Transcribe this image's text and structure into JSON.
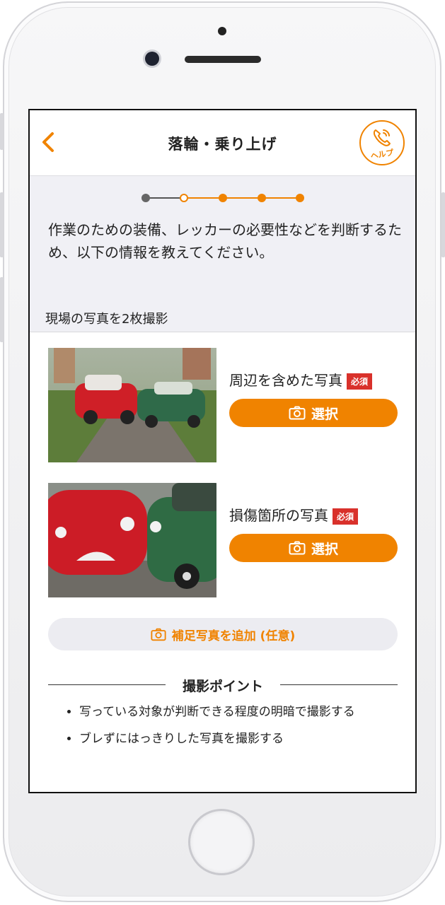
{
  "header": {
    "title": "落輪・乗り上げ",
    "help_label": "ヘルプ"
  },
  "colors": {
    "accent": "#f08300",
    "required": "#d9312b",
    "panel": "#f0f0f5"
  },
  "progress": {
    "total_steps": 5,
    "current_step": 2
  },
  "intro": {
    "text": "作業のための装備、レッカーの必要性などを判断するため、以下の情報を教えてください。"
  },
  "photos": {
    "section_title": "現場の写真を2枚撮影",
    "items": [
      {
        "label": "周辺を含めた写真",
        "badge": "必須",
        "button": "選択"
      },
      {
        "label": "損傷箇所の写真",
        "badge": "必須",
        "button": "選択"
      }
    ],
    "add_button": "補足写真を追加 (任意)"
  },
  "points": {
    "title": "撮影ポイント",
    "items": [
      "写っている対象が判断できる程度の明暗で撮影する",
      "ブレずにはっきりした写真を撮影する"
    ]
  }
}
